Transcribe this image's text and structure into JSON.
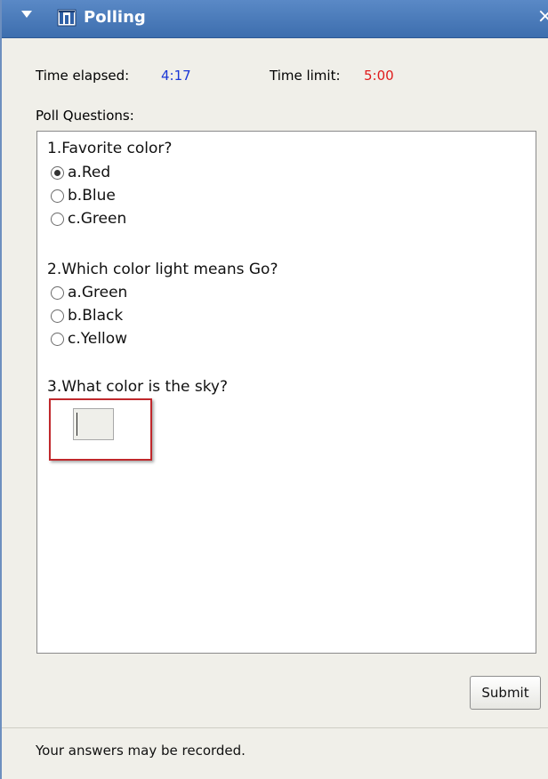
{
  "window": {
    "title": "Polling",
    "close_glyph": "×",
    "icons": [
      "collapse-chevron-icon",
      "polling-app-icon",
      "close-icon"
    ],
    "accent_color": "#3d6eae"
  },
  "timer": {
    "elapsed_label": "Time elapsed:",
    "elapsed_value": "4:17",
    "limit_label": "Time limit:",
    "limit_value": "5:00",
    "elapsed_color": "#1a37d6",
    "limit_color": "#e01b1b"
  },
  "poll": {
    "section_label": "Poll Questions:",
    "questions": [
      {
        "text": "1.Favorite color?",
        "options": [
          {
            "label": "a.Red",
            "selected": true
          },
          {
            "label": "b.Blue",
            "selected": false
          },
          {
            "label": "c.Green",
            "selected": false
          }
        ]
      },
      {
        "text": "2.Which color light means Go?",
        "options": [
          {
            "label": "a.Green",
            "selected": false
          },
          {
            "label": "b.Black",
            "selected": false
          },
          {
            "label": "c.Yellow",
            "selected": false
          }
        ]
      },
      {
        "text": "3.What color is the sky?",
        "answer_value": ""
      }
    ]
  },
  "actions": {
    "submit_label": "Submit"
  },
  "footer": {
    "text": "Your answers may be recorded."
  }
}
